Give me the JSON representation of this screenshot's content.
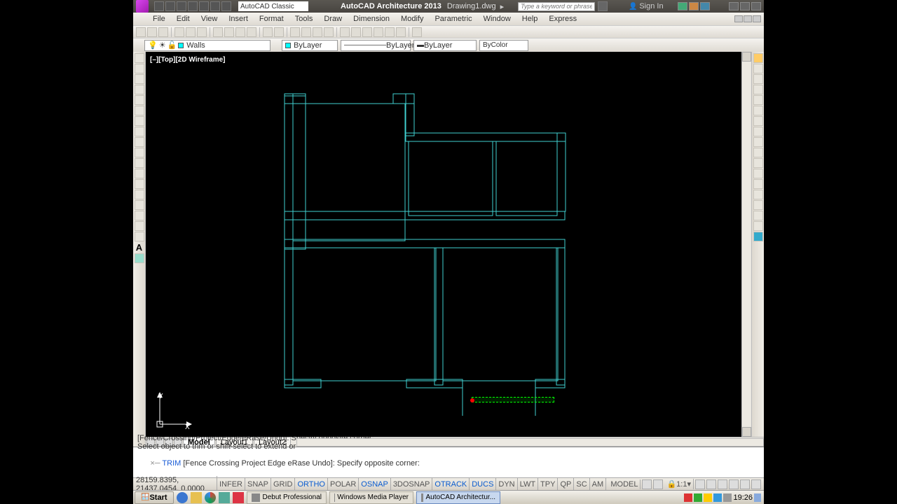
{
  "titlebar": {
    "workspace": "AutoCAD Classic",
    "app_title": "AutoCAD Architecture 2013",
    "file_name": "Drawing1.dwg",
    "search_placeholder": "Type a keyword or phrase",
    "signin": "Sign In"
  },
  "menus": [
    "File",
    "Edit",
    "View",
    "Insert",
    "Format",
    "Tools",
    "Draw",
    "Dimension",
    "Modify",
    "Parametric",
    "Window",
    "Help",
    "Express"
  ],
  "layer_bar": {
    "current_layer": "Walls",
    "bylayer1": "ByLayer",
    "bylayer2": "ByLayer",
    "bylayer3": "ByLayer",
    "bycolor": "ByColor"
  },
  "viewport_label": "[–][Top][2D Wireframe]",
  "ucs": {
    "y_label": "Y",
    "x_label": "X"
  },
  "tabs": {
    "model": "Model",
    "layout1": "Layout1",
    "layout2": "Layout2"
  },
  "command": {
    "line1": "[Fence/Crossing/Project/Edge/eRase/Undo]: Specify opposite corner:",
    "line2": "Select object to trim or shift-select to extend or",
    "prompt_cmd": "TRIM",
    "prompt_opts": "[Fence Crossing Project Edge eRase Undo]:",
    "prompt_tail": "Specify opposite corner:"
  },
  "status": {
    "coords": "28159.8395, 21437.0454, 0.0000",
    "toggles": [
      "INFER",
      "SNAP",
      "GRID",
      "ORTHO",
      "POLAR",
      "OSNAP",
      "3DOSNAP",
      "OTRACK",
      "DUCS",
      "DYN",
      "LWT",
      "TPY",
      "QP",
      "SC",
      "AM"
    ],
    "toggles_on": [
      "ORTHO",
      "OSNAP",
      "OTRACK",
      "DUCS"
    ],
    "model_btn": "MODEL",
    "scale": "1:1"
  },
  "taskbar": {
    "start": "Start",
    "tasks": [
      {
        "label": "Debut Professional",
        "active": false
      },
      {
        "label": "Windows Media Player",
        "active": false
      },
      {
        "label": "AutoCAD Architectur...",
        "active": true
      }
    ],
    "clock": "19:26"
  }
}
